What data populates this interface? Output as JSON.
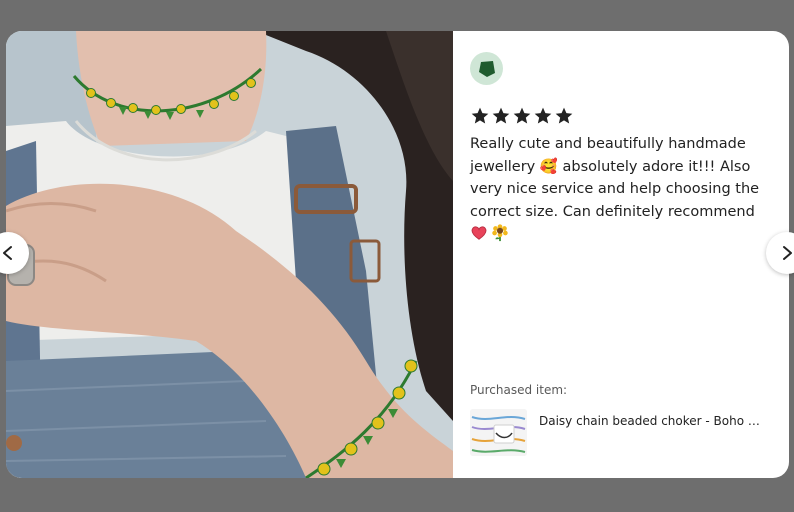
{
  "review": {
    "rating": 5,
    "max_rating": 5,
    "text": "Really cute and beautifully handmade jewellery 🥰 absolutely adore it!!! Also very nice service and help choosing the correct size. Can definitely recommend",
    "trailing_emojis": [
      "heart",
      "sunflower"
    ]
  },
  "shop": {
    "avatar_icon": "shop-logo-icon",
    "avatar_bg": "#cfe6d6",
    "avatar_fg": "#1f5b2e"
  },
  "purchased": {
    "label": "Purchased item:",
    "item_title": "Daisy chain beaded choker - Boho mul..."
  },
  "navigation": {
    "prev_icon": "chevron-left-icon",
    "next_icon": "chevron-right-icon"
  },
  "colors": {
    "star": "#222222",
    "overlay": "#6e6e6e",
    "text": "#222222",
    "muted": "#595959"
  }
}
